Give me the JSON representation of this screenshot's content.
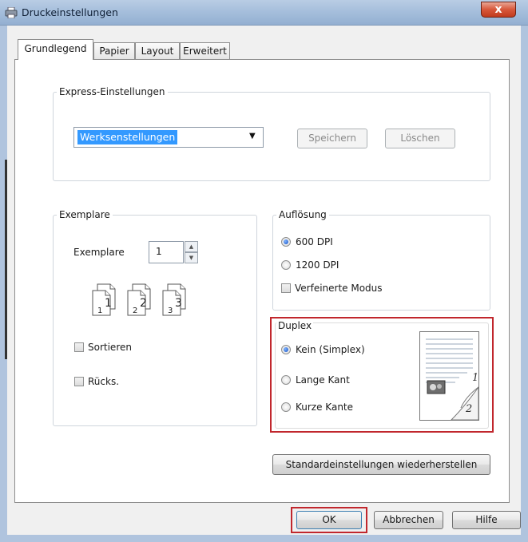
{
  "window": {
    "title": "Druckeinstellungen",
    "close_glyph": "x"
  },
  "tabs": [
    {
      "label": "Grundlegend",
      "active": true
    },
    {
      "label": "Papier",
      "active": false
    },
    {
      "label": "Layout",
      "active": false
    },
    {
      "label": "Erweitert",
      "active": false
    }
  ],
  "express": {
    "legend": "Express-Einstellungen",
    "selected": "Werksenstellungen",
    "save_label": "Speichern",
    "delete_label": "Löschen"
  },
  "copies": {
    "legend": "Exemplare",
    "field_label": "Exemplare",
    "value": "1",
    "collate_label": "Sortieren",
    "reverse_label": "Rücks.",
    "collate_checked": false,
    "reverse_checked": false,
    "icon_pages": [
      {
        "small": "1",
        "big": "1"
      },
      {
        "small": "2",
        "big": "2"
      },
      {
        "small": "3",
        "big": "3"
      }
    ]
  },
  "resolution": {
    "legend": "Auflösung",
    "options": [
      "600 DPI",
      "1200 DPI"
    ],
    "selected": "600 DPI",
    "refined_label": "Verfeinerte Modus",
    "refined_checked": false
  },
  "duplex": {
    "legend": "Duplex",
    "options": [
      "Kein (Simplex)",
      "Lange Kant",
      "Kurze Kante"
    ],
    "selected": "Kein (Simplex)",
    "preview_labels": [
      "1",
      "2"
    ]
  },
  "restore_label": "Standardeinstellungen wiederherstellen",
  "footer": {
    "ok": "OK",
    "cancel": "Abbrechen",
    "help": "Hilfe"
  },
  "colors": {
    "highlight": "#c1272d",
    "titlebar": "#a6bfdc",
    "selection": "#3399ff"
  }
}
